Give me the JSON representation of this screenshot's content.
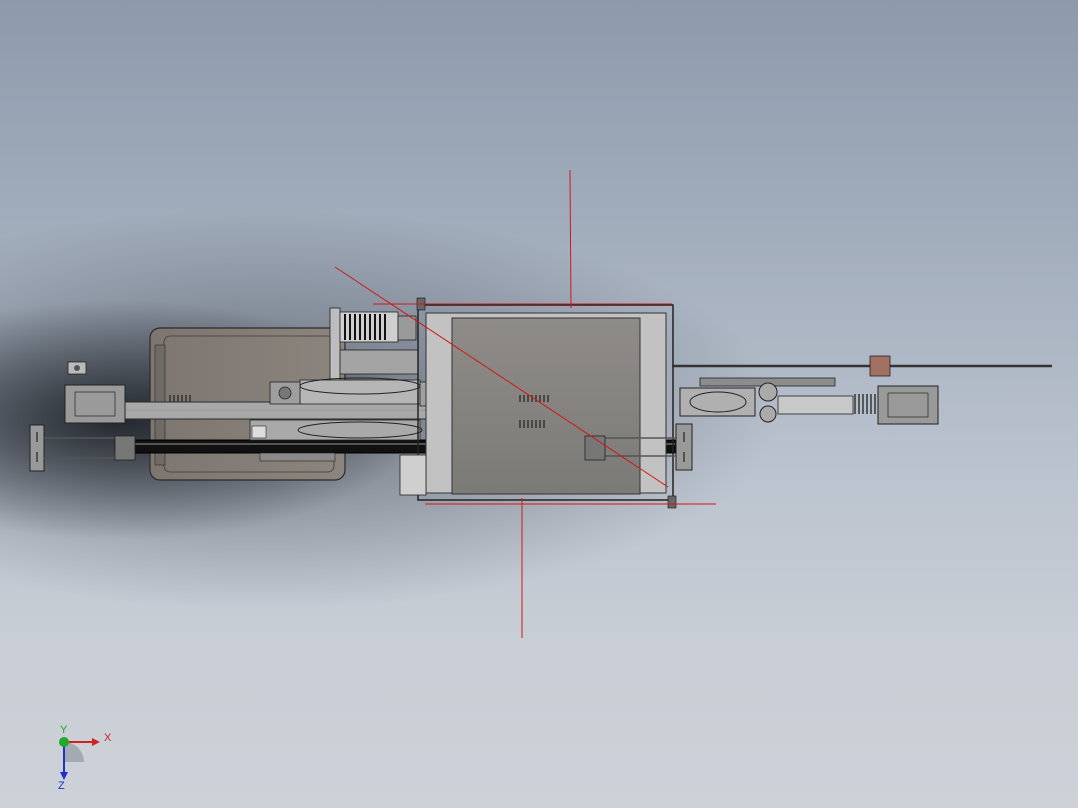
{
  "viewport": {
    "background_top": "#8e9aac",
    "background_bottom": "#cdd1d8",
    "sketch_line_color": "#d01818"
  },
  "triad": {
    "x_label": "X",
    "y_label": "Y",
    "z_label": "Z",
    "x_color": "#d42020",
    "y_color": "#1eaa2a",
    "z_color": "#2030c8"
  }
}
